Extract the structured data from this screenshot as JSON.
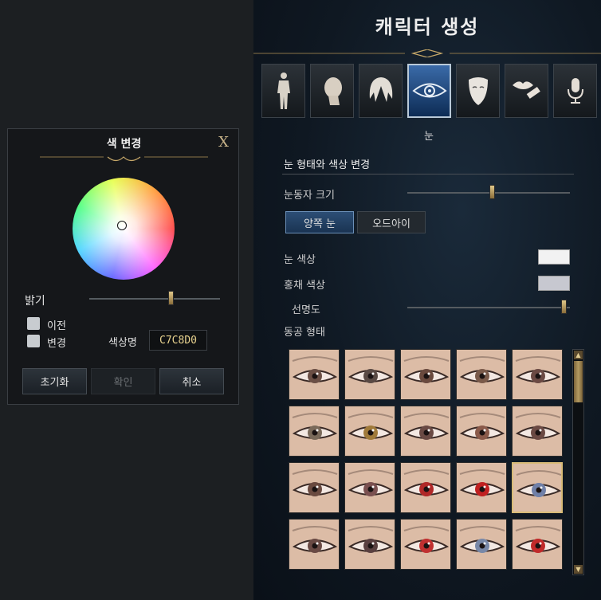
{
  "header": {
    "title": "캐릭터 생성"
  },
  "tabs": [
    {
      "icon": "body-icon"
    },
    {
      "icon": "head-icon"
    },
    {
      "icon": "hair-icon"
    },
    {
      "icon": "eye-icon",
      "active": true
    },
    {
      "icon": "face-mask-icon"
    },
    {
      "icon": "lips-icon"
    },
    {
      "icon": "microphone-icon"
    }
  ],
  "active_tab_label": "눈",
  "eye_panel": {
    "section_title": "눈 형태와 색상 변경",
    "pupil_size_label": "눈동자 크기",
    "pupil_size_value": 0.52,
    "eye_buttons": {
      "both": "양쪽 눈",
      "odd": "오드아이"
    },
    "eye_color_label": "눈 색상",
    "eye_color": "#F2F2F2",
    "iris_color_label": "홍채 색상",
    "iris_color": "#C7C8D0",
    "clarity_label": "선명도",
    "clarity_value": 0.96,
    "pupil_shape_label": "동공 형태",
    "pupil_tints": [
      [
        "#6b4f45",
        "#5a4a44",
        "#6a4a3e",
        "#7a5a4a",
        "#6b4a44"
      ],
      [
        "#7a6a5a",
        "#a07a3a",
        "#6a4a44",
        "#8a5a4a",
        "#6b4a44"
      ],
      [
        "#6a4a40",
        "#7a5050",
        "#b02828",
        "#c02020",
        "#7080a8"
      ],
      [
        "#6a4a44",
        "#5a4040",
        "#c03030",
        "#7888a8",
        "#c02a2a"
      ]
    ],
    "selected_cell": [
      2,
      4
    ]
  },
  "color_dialog": {
    "title": "색 변경",
    "close": "X",
    "brightness_label": "밝기",
    "brightness_value": 0.62,
    "prev_label": "이전",
    "change_label": "변경",
    "color_name_label": "색상명",
    "hex_value": "C7C8D0",
    "buttons": {
      "reset": "초기화",
      "confirm": "확인",
      "cancel": "취소"
    }
  }
}
